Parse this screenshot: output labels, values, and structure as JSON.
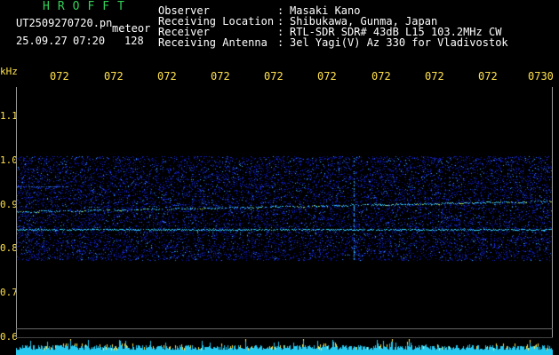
{
  "header": {
    "app_title": "HROFFT",
    "file_name": "UT2509270720.pn",
    "file_tag": "meteor",
    "date": "25.09.27",
    "time": "07:20",
    "count": "128"
  },
  "meta": {
    "observer_label": "Observer",
    "observer_value": "Masaki Kano",
    "location_label": "Receiving Location",
    "location_value": "Shibukawa, Gunma, Japan",
    "receiver_label": "Receiver",
    "receiver_value": "RTL-SDR SDR# 43dB L15 103.2MHz CW",
    "antenna_label": "Receiving Antenna",
    "antenna_value": "3el Yagi(V) Az 330 for Vladivostok",
    "separator": ":"
  },
  "axes": {
    "y_unit": "kHz",
    "y_ticks": [
      "1.1",
      "1.0",
      "0.9",
      "0.8",
      "0.7",
      "0.6"
    ],
    "x_ticks": [
      "072",
      "072",
      "072",
      "072",
      "072",
      "072",
      "072",
      "072",
      "072",
      "0730"
    ]
  },
  "colors": {
    "title_green": "#34d058",
    "axis_yellow": "#ffe14d",
    "signal_cyan": "#35e3ff",
    "noise_blue": "#1a2bd6"
  }
}
